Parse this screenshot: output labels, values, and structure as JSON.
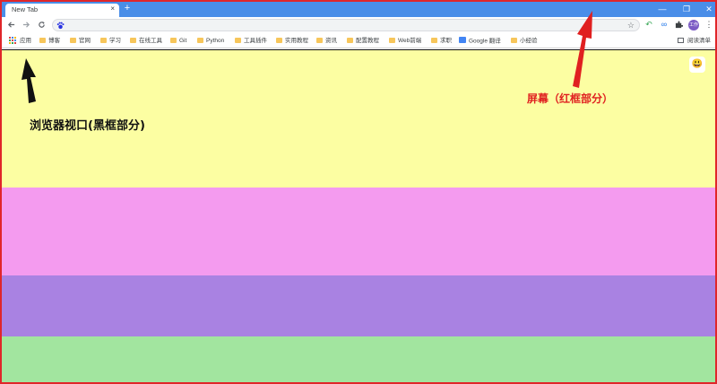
{
  "browser": {
    "tab_title": "New Tab",
    "tab_close": "×",
    "new_tab": "+",
    "window_controls": {
      "minimize": "—",
      "restore": "❐",
      "close": "✕"
    },
    "address": "",
    "avatar_text": "工作"
  },
  "bookmarks": {
    "apps_label": "应用",
    "items": [
      "博客",
      "官网",
      "学习",
      "在线工具",
      "Git",
      "Python",
      "工具插件",
      "实用教程",
      "资讯",
      "配置教程",
      "Web前端",
      "求职",
      "Google 翻译",
      "小经验"
    ],
    "reading_list": "阅读清单"
  },
  "annotations": {
    "viewport_label": "浏览器视口(黑框部分)",
    "screen_label": "屏幕（红框部分）"
  },
  "colors": {
    "frame": "#e0262a",
    "tab_strip": "#4a8ee8",
    "band_yellow": "#fcfea2",
    "band_pink": "#f49bef",
    "band_purple": "#a982e2",
    "band_green": "#a2e59f"
  },
  "icons": {
    "back": "arrow-left-icon",
    "forward": "arrow-right-icon",
    "reload": "reload-icon",
    "site": "baidu-paw-icon",
    "bookmark_star": "star-icon",
    "extensions": "puzzle-icon",
    "apps": "apps-grid-icon",
    "badge": "emoji-face-icon"
  }
}
